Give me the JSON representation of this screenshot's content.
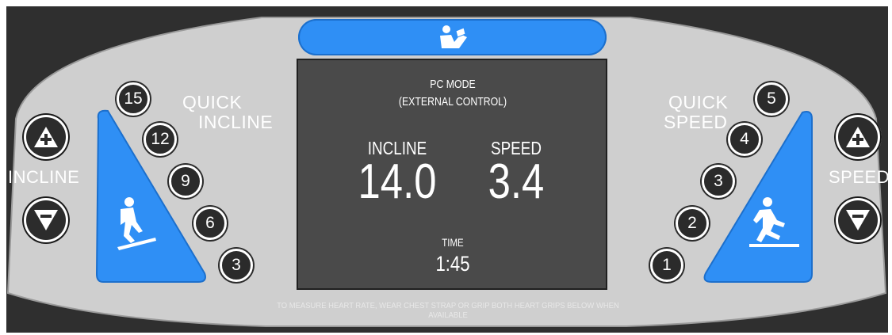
{
  "console": {
    "colors": {
      "panel": "#cfcfcf",
      "accent": "#2f8ff5",
      "screen": "#4a4a4a",
      "frame": "#2f2f2f"
    }
  },
  "left": {
    "quick_label_line1": "QUICK",
    "quick_label_line2": "INCLINE",
    "side_label": "INCLINE",
    "presets": [
      "15",
      "12",
      "9",
      "6",
      "3"
    ],
    "icon": "hiker-icon"
  },
  "right": {
    "quick_label_line1": "QUICK",
    "quick_label_line2": "SPEED",
    "side_label": "SPEED",
    "presets": [
      "5",
      "4",
      "3",
      "2",
      "1"
    ],
    "icon": "runner-icon"
  },
  "top_button": {
    "icon": "manual-reader-icon"
  },
  "screen": {
    "mode_line1": "PC MODE",
    "mode_line2": "(EXTERNAL CONTROL)",
    "incline_label": "INCLINE",
    "incline_value": "14.0",
    "speed_label": "SPEED",
    "speed_value": "3.4",
    "time_label": "TIME",
    "time_value": "1:45"
  },
  "footer_text": "TO MEASURE HEART RATE, WEAR CHEST STRAP OR GRIP BOTH HEART GRIPS BELOW WHEN AVAILABLE"
}
